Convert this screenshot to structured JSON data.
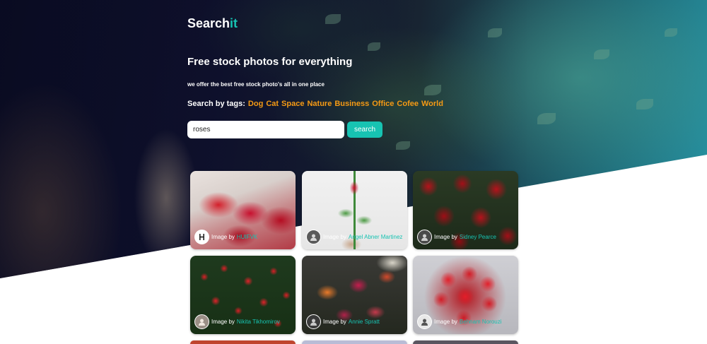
{
  "brand": {
    "name_main": "Search",
    "name_accent": "it",
    "accent_color": "#17c3b2"
  },
  "hero": {
    "headline": "Free stock photos for everything",
    "tagline": "we offer the best free stock photo's all in one place"
  },
  "tags": {
    "label": "Search by tags:",
    "items": [
      "Dog",
      "Cat",
      "Space",
      "Nature",
      "Business",
      "Office",
      "Cofee",
      "World"
    ],
    "color": "#f59a14"
  },
  "search": {
    "value": "roses",
    "button_label": "search"
  },
  "results": {
    "credit_prefix": "Image by",
    "cards": [
      {
        "author": "HUIFVK",
        "avatar_icon": "photographer-logo-icon"
      },
      {
        "author": "Angel Abner Martinez",
        "avatar_icon": "user-avatar-icon"
      },
      {
        "author": "Sidney Pearce",
        "avatar_icon": "user-avatar-icon"
      },
      {
        "author": "Nikita Tikhomirov",
        "avatar_icon": "user-avatar-icon"
      },
      {
        "author": "Annie Spratt",
        "avatar_icon": "user-avatar-icon"
      },
      {
        "author": "Behnam Norouzi",
        "avatar_icon": "user-avatar-icon"
      }
    ]
  }
}
